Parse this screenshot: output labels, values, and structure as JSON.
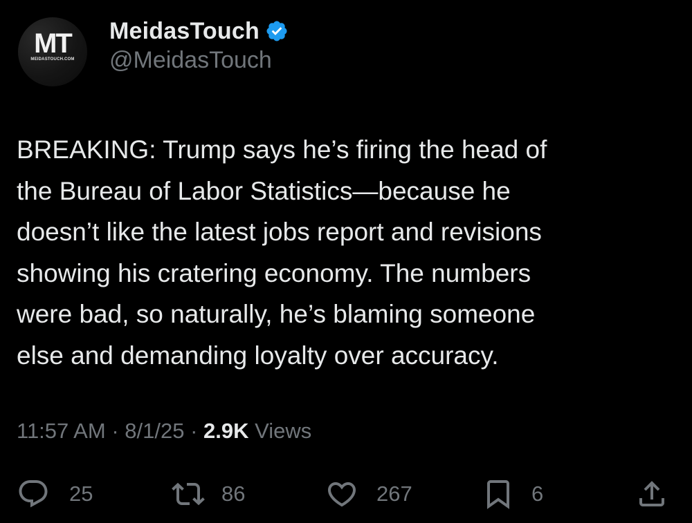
{
  "author": {
    "display_name": "MeidasTouch",
    "handle": "@MeidasTouch",
    "verified": true,
    "avatar_mark": "MT",
    "avatar_subtext": "MEIDASTOUCH.COM"
  },
  "tweet": {
    "text": "BREAKING: Trump says he’s firing the head of\nthe Bureau of Labor Statistics—because he\ndoesn’t like the latest jobs report and revisions\nshowing his cratering economy. The numbers\nwere bad, so naturally, he’s blaming someone\nelse and demanding loyalty over accuracy."
  },
  "meta": {
    "time": "11:57 AM",
    "separator": "·",
    "date": "8/1/25",
    "views_count": "2.9K",
    "views_label": "Views"
  },
  "actions": {
    "reply": {
      "icon": "reply-icon",
      "count": "25"
    },
    "repost": {
      "icon": "repost-icon",
      "count": "86"
    },
    "like": {
      "icon": "like-icon",
      "count": "267"
    },
    "bookmark": {
      "icon": "bookmark-icon",
      "count": "6"
    },
    "share": {
      "icon": "share-icon"
    }
  },
  "colors": {
    "background": "#000000",
    "primary_text": "#e7e9ea",
    "secondary_text": "#71767b",
    "verified_badge": "#1d9bf0"
  }
}
